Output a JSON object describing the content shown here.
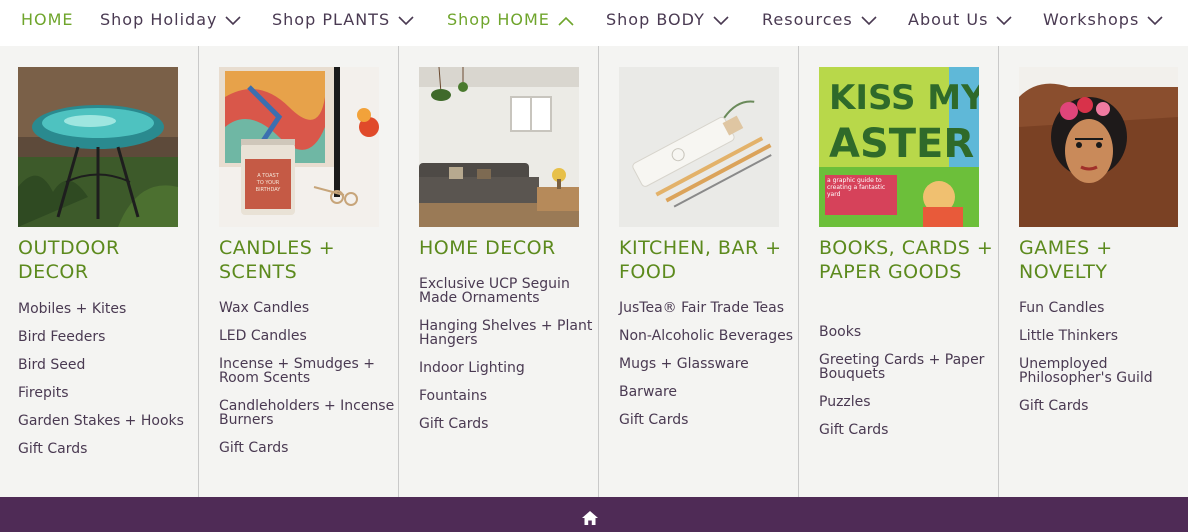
{
  "nav": {
    "items": [
      {
        "label": "HOME"
      },
      {
        "label": "Shop Holiday"
      },
      {
        "label": "Shop PLANTS"
      },
      {
        "label": "Shop HOME"
      },
      {
        "label": "Shop BODY"
      },
      {
        "label": "Resources"
      },
      {
        "label": "About Us"
      },
      {
        "label": "Workshops"
      }
    ]
  },
  "menu": {
    "columns": [
      {
        "title": "OUTDOOR DECOR",
        "image_icon": "birdbath-photo",
        "links": [
          "Mobiles + Kites",
          "Bird Feeders",
          "Bird Seed",
          "Firepits",
          "Garden Stakes + Hooks",
          "Gift Cards"
        ]
      },
      {
        "title": "CANDLES + SCENTS",
        "image_icon": "candle-photo",
        "image_text": "A TOAST TO YOUR BIRTHDAY",
        "links": [
          "Wax Candles",
          "LED Candles",
          "Incense + Smudges + Room Scents",
          "Candleholders + Incense Burners",
          "Gift Cards"
        ]
      },
      {
        "title": "HOME DECOR",
        "image_icon": "living-room-photo",
        "links": [
          "Exclusive UCP Seguin Made Ornaments",
          "Hanging Shelves + Plant Hangers",
          "Indoor Lighting",
          "Fountains",
          "Gift Cards"
        ]
      },
      {
        "title": "KITCHEN, BAR + FOOD",
        "image_icon": "straws-photo",
        "links": [
          "JusTea® Fair Trade Teas",
          "Non-Alcoholic Beverages",
          "Mugs + Glassware",
          "Barware",
          "Gift Cards"
        ]
      },
      {
        "title": "BOOKS, CARDS + PAPER GOODS",
        "image_icon": "book-cover-photo",
        "image_text": {
          "line1": "KISS MY",
          "line2": "ASTER",
          "subtitle": "a graphic guide to creating a fantastic yard"
        },
        "links": [
          "Books",
          "Greeting Cards + Paper Bouquets",
          "Puzzles",
          "Gift Cards"
        ]
      },
      {
        "title": "GAMES + NOVELTY",
        "image_icon": "frida-doll-photo",
        "links": [
          "Fun Candles",
          "Little Thinkers",
          "Unemployed Philosopher's Guild",
          "Gift Cards"
        ]
      }
    ]
  },
  "bottom_bar": {
    "icon": "home-icon"
  },
  "colors": {
    "green": "#6fa52c",
    "title_green": "#5c8a1d",
    "purple_text": "#4a3a52",
    "bar_purple": "#4f2b56",
    "panel_bg": "#f4f4f2"
  }
}
